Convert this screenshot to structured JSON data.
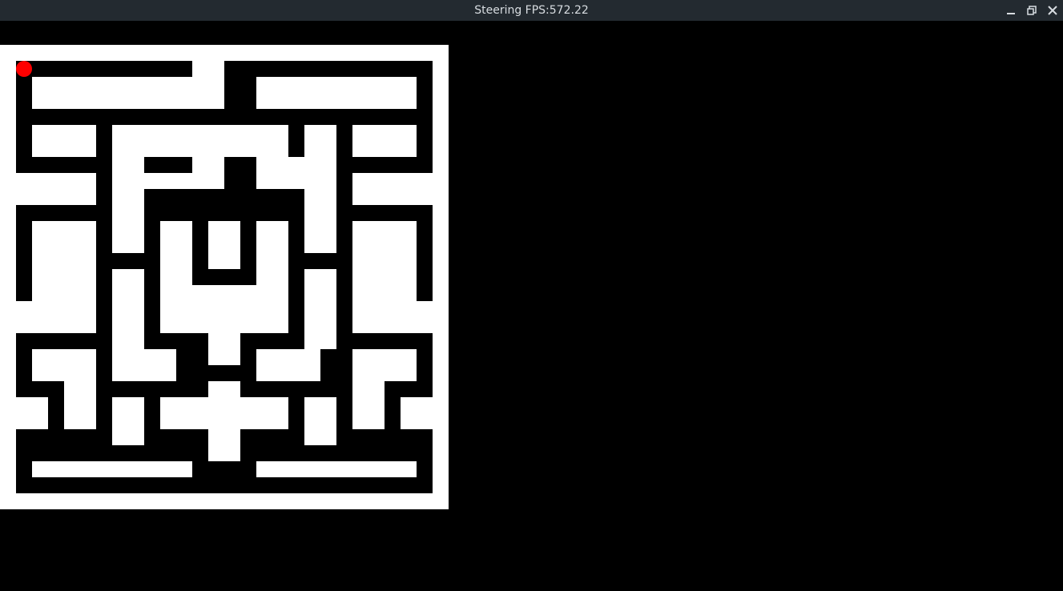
{
  "window": {
    "title": "Steering FPS:572.22",
    "icons": [
      "minimize-icon",
      "maximize-icon",
      "close-icon"
    ]
  },
  "maze": {
    "cols": 14,
    "rows": 14,
    "wall_color": "#ffffff",
    "path_color": "#000000",
    "agent_color": "#ff0000",
    "agent_cell": [
      0,
      0
    ],
    "wall_rects_cells": [
      [
        0,
        0,
        14,
        0.5
      ],
      [
        0,
        14,
        14,
        0.5
      ],
      [
        0,
        0,
        0.5,
        14.5
      ],
      [
        13.5,
        0,
        0.5,
        14.5
      ],
      [
        6,
        0,
        1,
        2
      ],
      [
        1,
        1,
        2,
        1
      ],
      [
        3,
        1,
        3,
        1
      ],
      [
        8,
        1,
        3,
        1
      ],
      [
        11,
        1,
        2,
        1
      ],
      [
        1,
        2.5,
        2,
        1
      ],
      [
        11,
        2.5,
        2,
        1
      ],
      [
        3.5,
        2.5,
        1,
        4
      ],
      [
        4.5,
        2.5,
        4.5,
        1
      ],
      [
        6.5,
        3.5,
        0.5,
        1
      ],
      [
        6,
        3.5,
        0.5,
        1
      ],
      [
        4.5,
        4,
        1.5,
        0.5
      ],
      [
        8,
        3.5,
        1.5,
        1
      ],
      [
        9.5,
        2.5,
        1,
        4
      ],
      [
        0.5,
        4,
        2.5,
        1
      ],
      [
        11,
        4,
        2.5,
        1
      ],
      [
        1,
        5.5,
        2,
        2.5
      ],
      [
        11,
        5.5,
        2,
        2.5
      ],
      [
        5,
        5.5,
        1,
        2.5
      ],
      [
        5,
        7.5,
        4,
        0.5
      ],
      [
        8,
        5.5,
        1,
        2.5
      ],
      [
        6.5,
        5.5,
        1,
        1.5
      ],
      [
        3.5,
        7,
        1,
        2.5
      ],
      [
        9.5,
        7,
        1,
        2.5
      ],
      [
        0.5,
        8,
        2.5,
        1
      ],
      [
        11,
        8,
        2.5,
        1
      ],
      [
        5,
        8,
        4,
        1
      ],
      [
        6.5,
        9,
        1,
        1
      ],
      [
        1,
        9.5,
        2,
        1
      ],
      [
        2,
        10.5,
        1,
        1.5
      ],
      [
        3.5,
        9.5,
        2,
        1
      ],
      [
        8,
        9.5,
        2,
        1
      ],
      [
        11,
        9.5,
        2,
        1
      ],
      [
        11,
        10.5,
        1,
        1.5
      ],
      [
        6.5,
        10.5,
        1,
        1
      ],
      [
        0.5,
        11,
        1,
        1
      ],
      [
        12.5,
        11,
        1,
        1
      ],
      [
        3.5,
        11,
        1,
        1.5
      ],
      [
        5,
        11,
        4,
        1
      ],
      [
        9.5,
        11,
        1,
        1.5
      ],
      [
        6.5,
        12,
        1,
        1
      ],
      [
        1,
        13,
        5,
        0.5
      ],
      [
        8,
        13,
        5,
        0.5
      ]
    ]
  }
}
